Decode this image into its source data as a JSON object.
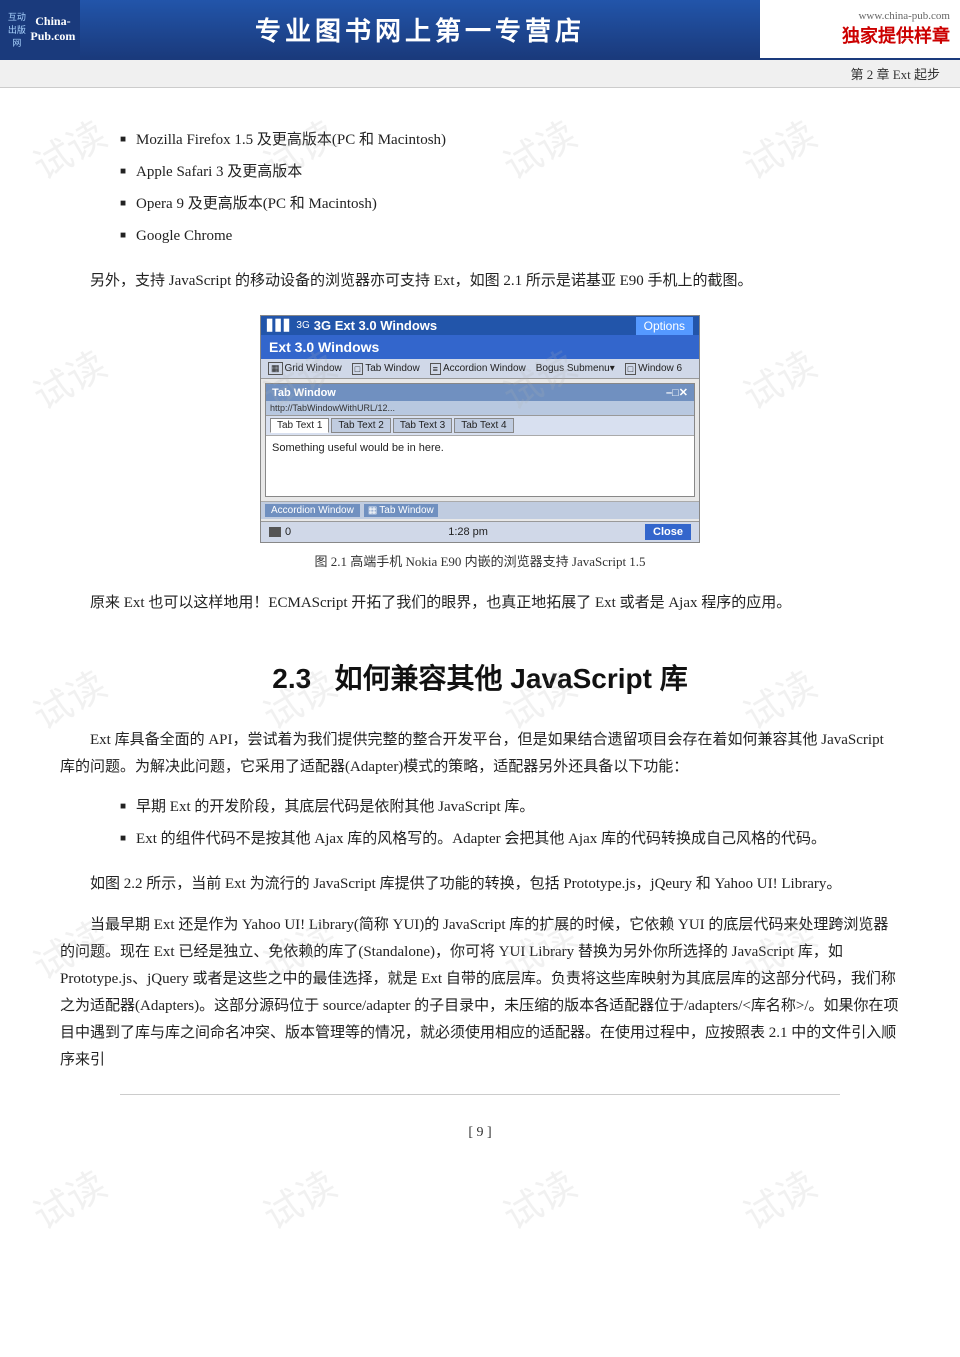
{
  "header": {
    "logo_top": "互动出版网",
    "logo_site": "China-Pub.com",
    "center_text": "专业图书网上第一专营店",
    "website": "www.china-pub.com",
    "exclusive": "独家提供样章"
  },
  "chapter_bar": {
    "text": "第 2 章   Ext 起步"
  },
  "bullet_items": [
    "Mozilla Firefox 1.5 及更高版本(PC 和 Macintosh)",
    "Apple Safari 3 及更高版本",
    "Opera 9 及更高版本(PC 和 Macintosh)",
    "Google Chrome"
  ],
  "para1": "另外，支持 JavaScript 的移动设备的浏览器亦可支持 Ext，如图 2.1 所示是诺基亚 E90 手机上的截图。",
  "figure": {
    "status_bar_left": "3G  Ext 3.0 Windows",
    "status_bar_right": "Options",
    "status_signal": "▋▋▋",
    "ext_title": "Ext 3.0 Windows",
    "nav_items": [
      "Grid Window",
      "Tab Window",
      "Accordion Window",
      "Bogus Submenu▾",
      "Window 6"
    ],
    "window_title": "Tab Window",
    "window_controls": "–□✕",
    "tabs": [
      "Tab Text 1",
      "Tab Text 2",
      "Tab Text 3",
      "Tab Text 4"
    ],
    "content_text": "Something useful would be in here.",
    "accordion_items": [
      "Accordion Window",
      "Tab Window"
    ],
    "bottom_left": "0",
    "bottom_time": "1:28 pm",
    "bottom_btn": "Close",
    "caption": "图 2.1    高端手机 Nokia E90 内嵌的浏览器支持 JavaScript 1.5"
  },
  "para2": "原来 Ext 也可以这样地用！ECMAScript 开拓了我们的眼界，也真正地拓展了 Ext 或者是 Ajax 程序的应用。",
  "section": {
    "number": "2.3",
    "title": "如何兼容其他 JavaScript 库"
  },
  "para3": "Ext 库具备全面的 API，尝试着为我们提供完整的整合开发平台，但是如果结合遗留项目会存在着如何兼容其他 JavaScript 库的问题。为解决此问题，它采用了适配器(Adapter)模式的策略，适配器另外还具备以下功能：",
  "bullet2_items": [
    "早期 Ext 的开发阶段，其底层代码是依附其他 JavaScript 库。",
    "Ext 的组件代码不是按其他 Ajax 库的风格写的。Adapter 会把其他 Ajax 库的代码转换成自己风格的代码。"
  ],
  "para4": "如图 2.2 所示，当前 Ext 为流行的 JavaScript 库提供了功能的转换，包括 Prototype.js，jQeury 和 Yahoo UI! Library。",
  "para5": "当最早期 Ext 还是作为 Yahoo UI! Library(简称 YUI)的 JavaScript 库的扩展的时候，它依赖 YUI 的底层代码来处理跨浏览器的问题。现在 Ext 已经是独立、免依赖的库了(Standalone)，你可将 YUI Library 替换为另外你所选择的 JavaScript 库，如 Prototype.js、jQuery 或者是这些之中的最佳选择，就是 Ext 自带的底层库。负责将这些库映射为其底层库的这部分代码，我们称之为适配器(Adapters)。这部分源码位于 source/adapter 的子目录中，未压缩的版本各适配器位于/adapters/<库名称>/。如果你在项目中遇到了库与库之间命名冲突、版本管理等的情况，就必须使用相应的适配器。在使用过程中，应按照表 2.1 中的文件引入顺序来引",
  "page_number": "[ 9 ]",
  "watermarks": [
    "试读",
    "试读",
    "试读",
    "试读",
    "试读",
    "试读",
    "试读",
    "试读",
    "试读",
    "试读",
    "试读",
    "试读"
  ]
}
